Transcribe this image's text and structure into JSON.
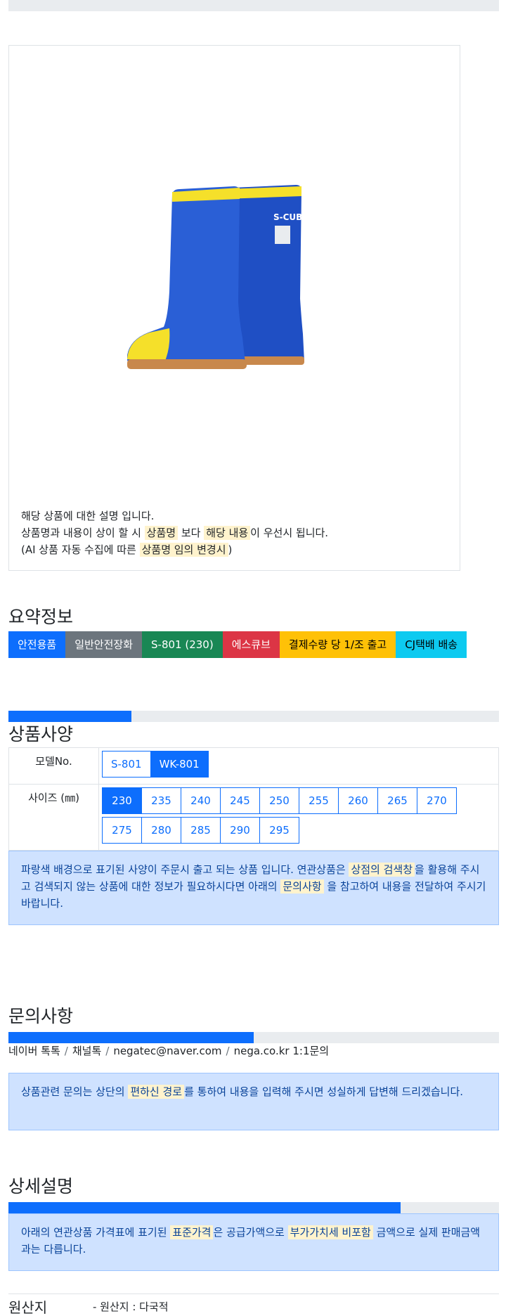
{
  "description": {
    "line1": "해당 상품에 대한 설명 입니다.",
    "line2_a": "상품명과 내용이 상이 할 시 ",
    "line2_hl1": "상품명",
    "line2_b": " 보다 ",
    "line2_hl2": "해당 내용",
    "line2_c": "이 우선시 됩니다.",
    "line3_a": "(AI 상품 자동 수집에 따른 ",
    "line3_hl": "상품명 임의 변경시",
    "line3_b": ")"
  },
  "product_image": {
    "brand_text": "S-CUBE",
    "colors": {
      "boot": "#1f4fc4",
      "accent": "#f5e02a",
      "sole": "#c8884c"
    }
  },
  "summary": {
    "title": "요약정보",
    "tags": [
      {
        "label": "안전용품",
        "color": "#0d6efd"
      },
      {
        "label": "일반안전장화",
        "color": "#6c757d"
      },
      {
        "label": "S-801 (230)",
        "color": "#198754"
      },
      {
        "label": "에스큐브",
        "color": "#dc3545"
      },
      {
        "label": "결제수량 당 1/조 출고",
        "color": "#ffc107"
      },
      {
        "label": "CJ택배 배송",
        "color": "#0dcaf0"
      }
    ]
  },
  "specs": {
    "title": "상품사양",
    "progress": 0.25,
    "model_label": "모델No.",
    "models": [
      {
        "label": "S-801",
        "active": false
      },
      {
        "label": "WK-801",
        "active": true
      }
    ],
    "size_label": "사이즈 (㎜)",
    "sizes": [
      {
        "label": "230",
        "active": true
      },
      {
        "label": "235",
        "active": false
      },
      {
        "label": "240",
        "active": false
      },
      {
        "label": "245",
        "active": false
      },
      {
        "label": "250",
        "active": false
      },
      {
        "label": "255",
        "active": false
      },
      {
        "label": "260",
        "active": false
      },
      {
        "label": "265",
        "active": false
      },
      {
        "label": "270",
        "active": false
      },
      {
        "label": "275",
        "active": false
      },
      {
        "label": "280",
        "active": false
      },
      {
        "label": "285",
        "active": false
      },
      {
        "label": "290",
        "active": false
      },
      {
        "label": "295",
        "active": false
      }
    ],
    "notice_a": "파랑색 배경으로 표기된 사양이 주문시 출고 되는 상품 입니다. 연관상품은 ",
    "notice_hl1": "상점의 검색창",
    "notice_b": "을 활용해 주시고 검색되지 않는 상품에 대한 정보가 필요하시다면 아래의 ",
    "notice_hl2": "문의사항",
    "notice_c": " 을 참고하여 내용을 전달하여 주시기 바랍니다."
  },
  "inquiry": {
    "title": "문의사항",
    "progress": 0.5,
    "channels": [
      "네이버 톡톡",
      "채널톡",
      "negatec@naver.com",
      "nega.co.kr 1:1문의"
    ],
    "separator": "/",
    "notice_a": "상품관련 문의는 상단의 ",
    "notice_hl": "편하신 경로",
    "notice_b": "를 통하여 내용을 입력해 주시면 성실하게 답변해 드리겠습니다."
  },
  "detail": {
    "title": "상세설명",
    "progress": 0.8,
    "notice_a": "아래의 연관상품 가격표에 표기된 ",
    "notice_hl1": "표준가격",
    "notice_b": "은 공급가액으로 ",
    "notice_hl2": "부가가치세 비포함",
    "notice_c": " 금액으로 실제 판매금액과는 다릅니다."
  },
  "origin": {
    "label": "원산지",
    "value": "- 원산지 : 다국적"
  }
}
